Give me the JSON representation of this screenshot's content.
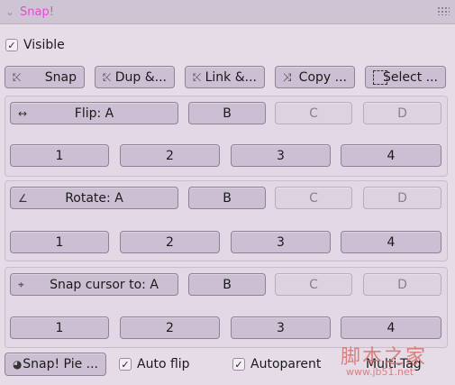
{
  "panel": {
    "title": "Snap!",
    "visible_label": "Visible",
    "visible_checked": "✓"
  },
  "toolbar": {
    "snap": "Snap",
    "dup": "Dup &...",
    "link": "Link &...",
    "copy": "Copy ...",
    "select": "Select ..."
  },
  "flip": {
    "label": "Flip: A",
    "b": "B",
    "c": "C",
    "d": "D",
    "n1": "1",
    "n2": "2",
    "n3": "3",
    "n4": "4"
  },
  "rotate": {
    "label": "Rotate: A",
    "b": "B",
    "c": "C",
    "d": "D",
    "n1": "1",
    "n2": "2",
    "n3": "3",
    "n4": "4"
  },
  "cursor": {
    "label": "Snap cursor to: A",
    "b": "B",
    "c": "C",
    "d": "D",
    "n1": "1",
    "n2": "2",
    "n3": "3",
    "n4": "4"
  },
  "footer": {
    "pie": "Snap! Pie ...",
    "auto_flip": "Auto flip",
    "auto_flip_checked": "✓",
    "autoparent": "Autoparent",
    "autoparent_checked": "✓",
    "multi": "Multi-Tag"
  },
  "watermark": {
    "cn": "脚本之家",
    "url": "www.jb51.net"
  }
}
